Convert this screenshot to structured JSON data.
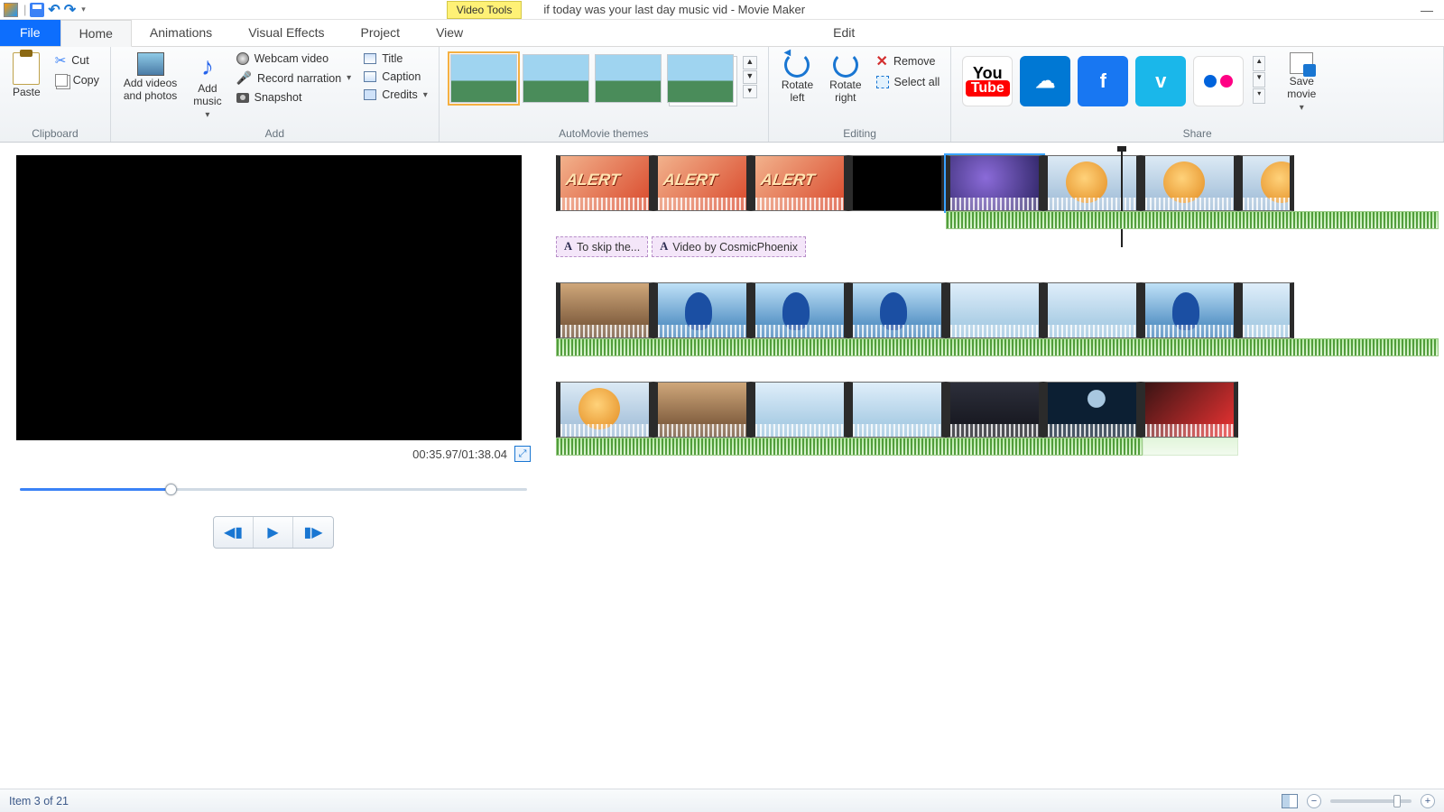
{
  "titlebar": {
    "context_tab": "Video Tools",
    "doc_title": "if today was your last day music vid - Movie Maker"
  },
  "tabs": {
    "file": "File",
    "home": "Home",
    "animations": "Animations",
    "visual_effects": "Visual Effects",
    "project": "Project",
    "view": "View",
    "edit": "Edit"
  },
  "ribbon": {
    "clipboard": {
      "paste": "Paste",
      "cut": "Cut",
      "copy": "Copy",
      "label": "Clipboard"
    },
    "add": {
      "add_videos": "Add videos\nand photos",
      "add_music": "Add\nmusic",
      "webcam": "Webcam video",
      "record_narration": "Record narration",
      "snapshot": "Snapshot",
      "title": "Title",
      "caption": "Caption",
      "credits": "Credits",
      "label": "Add"
    },
    "automovie": {
      "label": "AutoMovie themes"
    },
    "editing": {
      "rotate_left": "Rotate\nleft",
      "rotate_right": "Rotate\nright",
      "remove": "Remove",
      "select_all": "Select all",
      "label": "Editing"
    },
    "share": {
      "save_movie": "Save\nmovie",
      "label": "Share"
    }
  },
  "preview": {
    "time": "00:35.97/01:38.04",
    "seek_percent": 30
  },
  "timeline": {
    "captions": [
      "To skip the...",
      "Video by CosmicPhoenix"
    ],
    "playhead_row1_percent": 64
  },
  "status": {
    "item_text": "Item 3 of 21",
    "zoom_percent": 78
  }
}
